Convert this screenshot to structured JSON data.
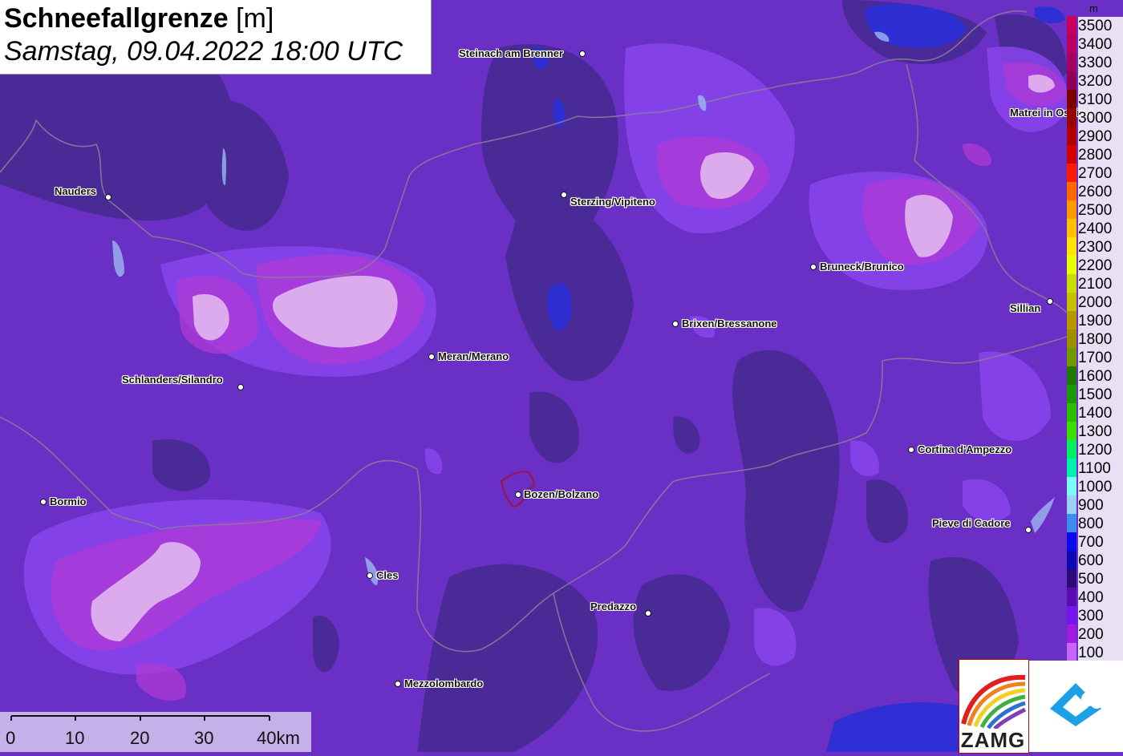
{
  "header": {
    "title_bold": "Schneefallgrenze",
    "title_unit": " [m]",
    "subtitle": "Samstag, 09.04.2022 18:00 UTC"
  },
  "cities": [
    {
      "name": "Steinach am Brenner",
      "id": "steinach"
    },
    {
      "name": "Nauders",
      "id": "nauders"
    },
    {
      "name": "Sterzing/Vipiteno",
      "id": "sterzing"
    },
    {
      "name": "Matrei in Osttirol",
      "id": "matrei"
    },
    {
      "name": "Bruneck/Brunico",
      "id": "bruneck"
    },
    {
      "name": "Sillian",
      "id": "sillian"
    },
    {
      "name": "Brixen/Bressanone",
      "id": "brixen"
    },
    {
      "name": "Meran/Merano",
      "id": "meran"
    },
    {
      "name": "Schlanders/Silandro",
      "id": "schlanders"
    },
    {
      "name": "Cortina d'Ampezzo",
      "id": "cortina"
    },
    {
      "name": "Bormio",
      "id": "bormio"
    },
    {
      "name": "Bozen/Bolzano",
      "id": "bozen"
    },
    {
      "name": "Pieve di Cadore",
      "id": "pieve"
    },
    {
      "name": "Cles",
      "id": "cles"
    },
    {
      "name": "Predazzo",
      "id": "predazzo"
    },
    {
      "name": "Mezzolombardo",
      "id": "mezzolombardo"
    }
  ],
  "legend": {
    "unit": "m",
    "entries": [
      {
        "label": "3500",
        "color": "#c8005a"
      },
      {
        "label": "3400",
        "color": "#b8005e"
      },
      {
        "label": "3300",
        "color": "#a40062"
      },
      {
        "label": "3200",
        "color": "#8c0058"
      },
      {
        "label": "3100",
        "color": "#7a0000"
      },
      {
        "label": "3000",
        "color": "#960000"
      },
      {
        "label": "2900",
        "color": "#b00000"
      },
      {
        "label": "2800",
        "color": "#d40000"
      },
      {
        "label": "2700",
        "color": "#ff1a00"
      },
      {
        "label": "2600",
        "color": "#ff6a00"
      },
      {
        "label": "2500",
        "color": "#ff9a00"
      },
      {
        "label": "2400",
        "color": "#ffc000"
      },
      {
        "label": "2300",
        "color": "#ffe600"
      },
      {
        "label": "2200",
        "color": "#e8ff00"
      },
      {
        "label": "2100",
        "color": "#c8dc00"
      },
      {
        "label": "2000",
        "color": "#c4c000"
      },
      {
        "label": "1900",
        "color": "#b49a00"
      },
      {
        "label": "1800",
        "color": "#a09000"
      },
      {
        "label": "1700",
        "color": "#6e9a00"
      },
      {
        "label": "1600",
        "color": "#1e7a00"
      },
      {
        "label": "1500",
        "color": "#1a9a00"
      },
      {
        "label": "1400",
        "color": "#28c000"
      },
      {
        "label": "1300",
        "color": "#3ae000"
      },
      {
        "label": "1200",
        "color": "#00f060"
      },
      {
        "label": "1100",
        "color": "#00f0b0"
      },
      {
        "label": "1000",
        "color": "#7afcfc"
      },
      {
        "label": "900",
        "color": "#9cd2f8"
      },
      {
        "label": "800",
        "color": "#3c8cf0"
      },
      {
        "label": "700",
        "color": "#0a0af0"
      },
      {
        "label": "600",
        "color": "#0a0ab4"
      },
      {
        "label": "500",
        "color": "#2a0a78"
      },
      {
        "label": "400",
        "color": "#5a0ab4"
      },
      {
        "label": "300",
        "color": "#7814f0"
      },
      {
        "label": "200",
        "color": "#a01ce0"
      },
      {
        "label": "100",
        "color": "#c864fa"
      }
    ]
  },
  "scale": {
    "labels": [
      "0",
      "10",
      "20",
      "30",
      "40km"
    ]
  },
  "logo": {
    "text": "ZAMG"
  },
  "colors": {
    "base": "#6a2fc4",
    "dark": "#4a2a96",
    "mid": "#7e3ee6",
    "light": "#9a58f0",
    "pink": "#b03ad6",
    "white_zone": "#e2b8f0",
    "blue": "#2a30d8",
    "border": "#8a7a9c"
  }
}
